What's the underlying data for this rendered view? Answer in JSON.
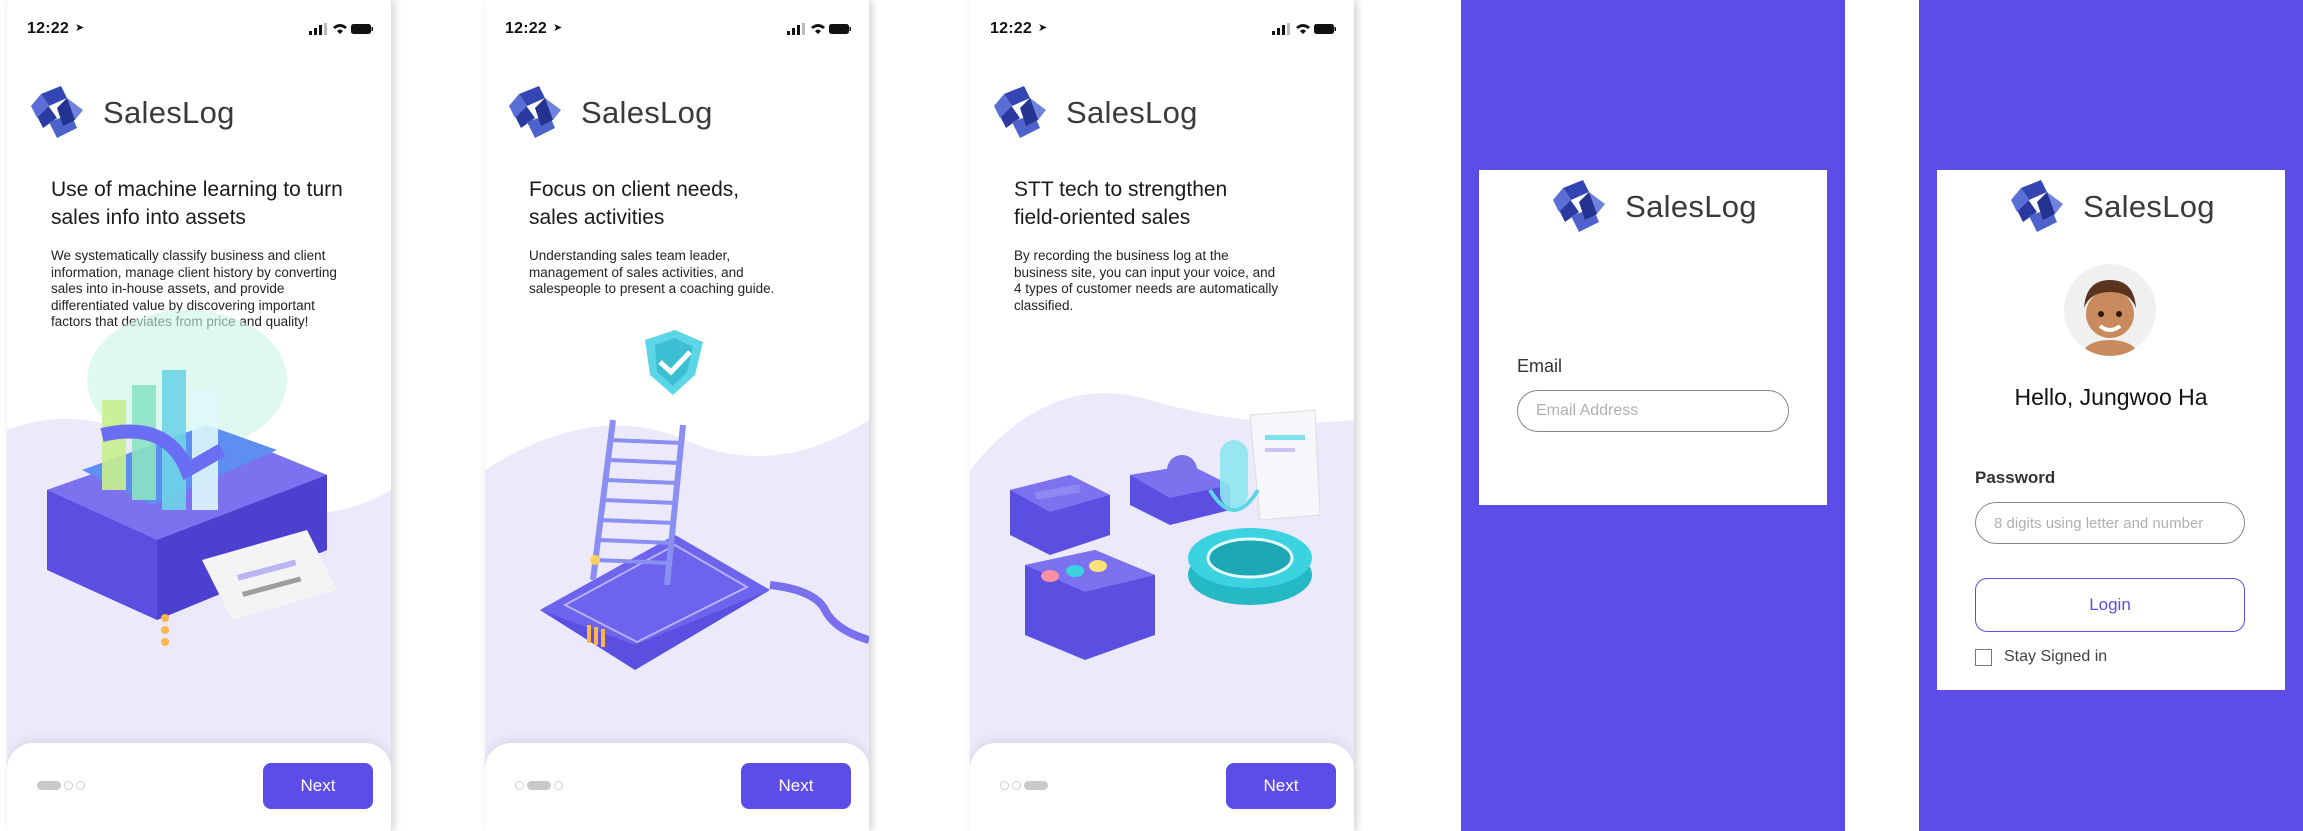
{
  "status_bar": {
    "time": "12:22"
  },
  "brand": {
    "name": "SalesLog",
    "color": "#5d4de8"
  },
  "onboarding": [
    {
      "headline": "Use of machine learning to turn sales info into assets",
      "body": "We systematically classify business and client information, manage client history by converting sales into in-house assets, and provide differentiated value by discovering important factors that deviates from price and quality!",
      "next_label": "Next",
      "page_index": 1
    },
    {
      "headline": "Focus on client needs, sales activities",
      "body": "Understanding sales team leader, management of sales activities, and salespeople to present a coaching guide.",
      "next_label": "Next",
      "page_index": 2
    },
    {
      "headline": "STT tech to strengthen field-oriented sales",
      "body": "By recording the business log at the business site, you can input your voice, and 4 types of customer needs are automatically classified.",
      "next_label": "Next",
      "page_index": 3
    }
  ],
  "email_screen": {
    "email_label": "Email",
    "email_placeholder": "Email Address"
  },
  "login_screen": {
    "greeting": "Hello, Jungwoo Ha",
    "password_label": "Password",
    "password_placeholder": "8 digits using letter and number",
    "login_label": "Login",
    "stay_signed_in_label": "Stay Signed in",
    "stay_signed_in_checked": false
  }
}
